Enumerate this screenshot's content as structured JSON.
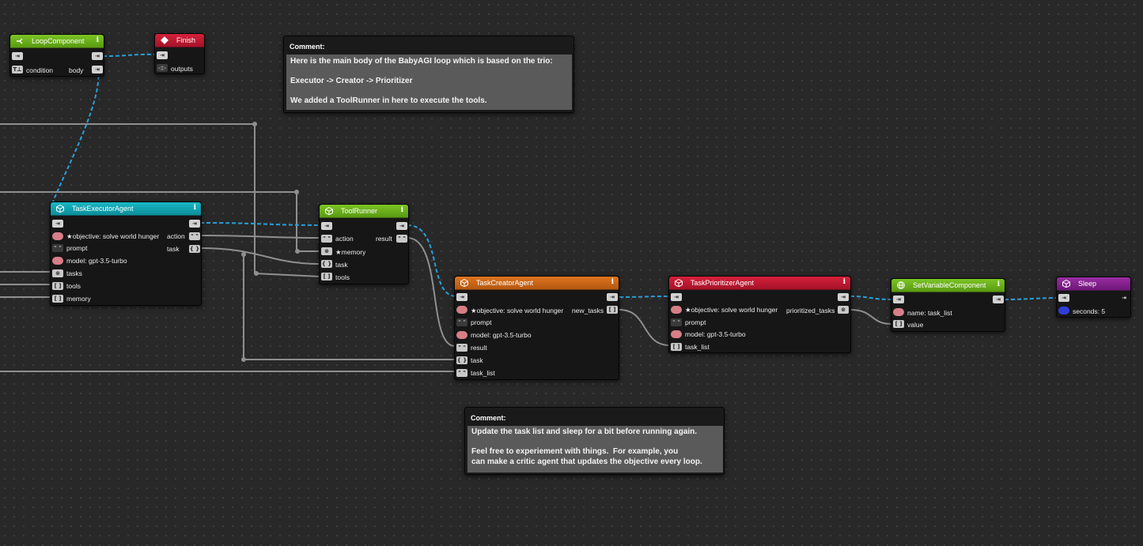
{
  "nodes": {
    "loop": {
      "title": "LoopComponent",
      "ports": {
        "condition": "condition",
        "body": "body"
      }
    },
    "finish": {
      "title": "Finish",
      "ports": {
        "outputs": "outputs"
      }
    },
    "executor": {
      "title": "TaskExecutorAgent",
      "ports": {
        "objective": "★objective: solve world hunger",
        "prompt": "prompt",
        "model": "model: gpt-3.5-turbo",
        "tasks": "tasks",
        "tools": "tools",
        "memory": "memory",
        "action": "action",
        "task": "task"
      }
    },
    "toolrunner": {
      "title": "ToolRunner",
      "ports": {
        "action": "action",
        "memory": "★memory",
        "task": "task",
        "tools": "tools",
        "result": "result"
      }
    },
    "creator": {
      "title": "TaskCreatorAgent",
      "ports": {
        "objective": "★objective: solve world hunger",
        "prompt": "prompt",
        "model": "model: gpt-3.5-turbo",
        "result": "result",
        "task": "task",
        "task_list": "task_list",
        "new_tasks": "new_tasks"
      }
    },
    "prioritizer": {
      "title": "TaskPrioritizerAgent",
      "ports": {
        "objective": "★objective: solve world hunger",
        "prompt": "prompt",
        "model": "model: gpt-3.5-turbo",
        "task_list": "task_list",
        "prioritized_tasks": "prioritized_tasks"
      }
    },
    "setvar": {
      "title": "SetVariableComponent",
      "ports": {
        "name": "name: task_list",
        "value": "value"
      }
    },
    "sleep": {
      "title": "Sleep",
      "ports": {
        "seconds": "seconds: 5"
      }
    }
  },
  "comments": [
    {
      "title": "Comment:",
      "text": "Here is the main body of the BabyAGI loop which is based on the trio:\n\nExecutor -> Creator -> Prioritizer\n\nWe added a ToolRunner in here to execute the tools."
    },
    {
      "title": "Comment:",
      "text": "Update the task list and sleep for a bit before running again.\n\nFeel free to experiement with things.  For example, you\ncan make a critic agent that updates the objective every loop."
    }
  ],
  "icons": {
    "loop": "branch-icon",
    "finish": "stop-diamond-icon",
    "agent": "cube-icon",
    "setvar": "globe-icon",
    "info": "info-icon"
  },
  "colors": {
    "exec_wire": "#2a9fd8",
    "data_wire": "#8a8a8a",
    "loop_header": "#6cb01c",
    "finish_header": "#c41a33",
    "executor_header": "#13a4b0",
    "creator_header": "#cc6818",
    "prioritizer_header": "#c41a33",
    "sleep_header": "#85218e"
  }
}
